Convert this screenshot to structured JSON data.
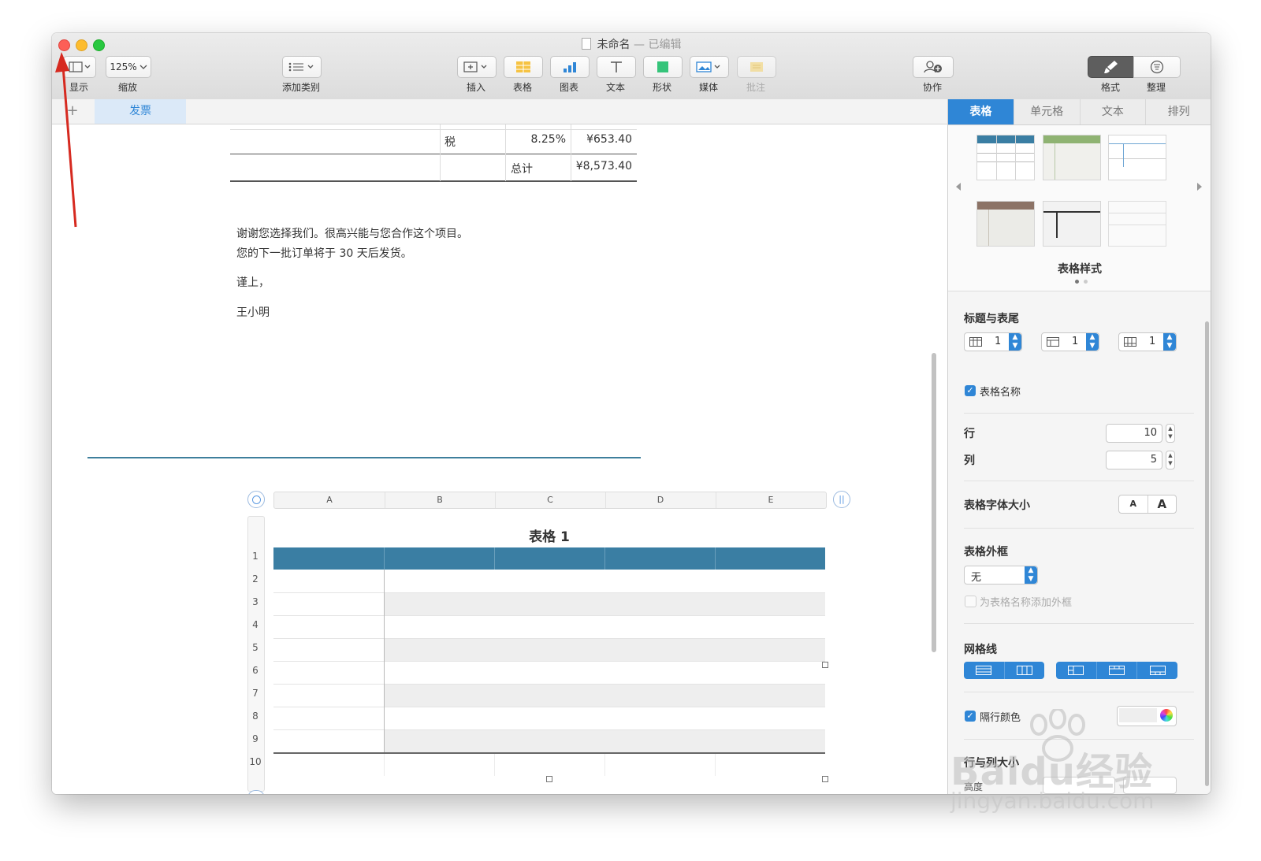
{
  "window": {
    "title": "未命名",
    "title_suffix": "— 已编辑"
  },
  "toolbar": {
    "display_label": "显示",
    "zoom_value": "125%",
    "zoom_label": "缩放",
    "add_category_label": "添加类别",
    "insert_label": "插入",
    "table_label": "表格",
    "chart_label": "图表",
    "text_label": "文本",
    "shape_label": "形状",
    "media_label": "媒体",
    "comment_label": "批注",
    "collaborate_label": "协作",
    "format_label": "格式",
    "organize_label": "整理"
  },
  "sheet_tabs": {
    "add": "+",
    "active_tab": "发票"
  },
  "invoice": {
    "tax_label": "税",
    "tax_rate": "8.25%",
    "tax_amount": "¥653.40",
    "total_label": "总计",
    "total_amount": "¥8,573.40",
    "line1": "谢谢您选择我们。很高兴能与您合作这个项目。",
    "line2": "您的下一批订单将于 30 天后发货。",
    "closing": "谨上，",
    "signature": "王小明"
  },
  "table": {
    "title": "表格 1",
    "columns": [
      "A",
      "B",
      "C",
      "D",
      "E"
    ],
    "rows": [
      "1",
      "2",
      "3",
      "4",
      "5",
      "6",
      "7",
      "8",
      "9",
      "10"
    ],
    "header_color": "#3a7ea3"
  },
  "sidebar": {
    "tabs": [
      "表格",
      "单元格",
      "文本",
      "排列"
    ],
    "active_tab_index": 0,
    "styles_caption": "表格样式",
    "header_footer_title": "标题与表尾",
    "header_rows": "1",
    "header_cols": "1",
    "footer_rows": "1",
    "table_name_checkbox": "表格名称",
    "rows_label": "行",
    "rows_value": "10",
    "cols_label": "列",
    "cols_value": "5",
    "font_size_title": "表格字体大小",
    "font_small": "A",
    "font_large": "A",
    "outline_title": "表格外框",
    "outline_value": "无",
    "outline_name_checkbox": "为表格名称添加外框",
    "gridlines_title": "网格线",
    "alt_row_color_label": "隔行颜色",
    "row_col_size_title": "行与列大小",
    "height_label": "高度"
  },
  "colors": {
    "accent": "#2f86d6",
    "annotation_arrow": "#d62a20",
    "table_header": "#3a7ea3"
  },
  "watermark": {
    "brand": "Baidu经验",
    "url": "jingyan.baidu.com"
  }
}
